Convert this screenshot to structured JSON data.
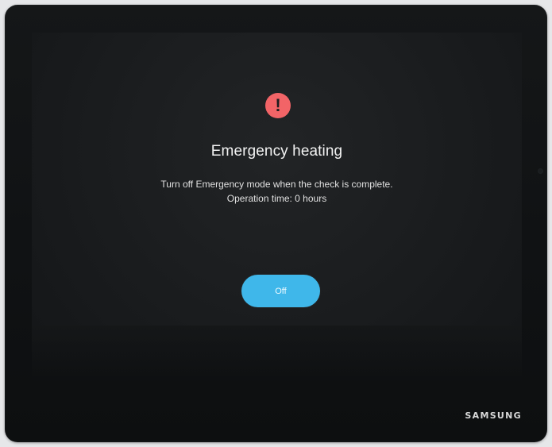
{
  "dialog": {
    "icon": "exclamation-icon",
    "icon_glyph": "!",
    "title": "Emergency heating",
    "message_line_1": "Turn off Emergency mode when the check is complete.",
    "message_line_2": "Operation time: 0 hours",
    "off_button_label": "Off"
  },
  "device": {
    "brand": "SAMSUNG"
  },
  "colors": {
    "alert": "#f26467",
    "button": "#3fb7ea",
    "screen": "#1c1e20",
    "bezel": "#121416"
  }
}
